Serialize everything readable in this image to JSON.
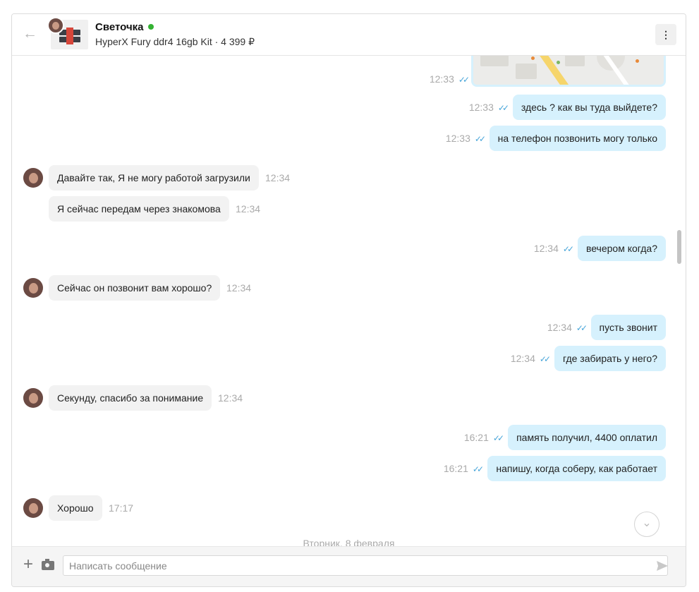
{
  "header": {
    "back_icon": "back-arrow-icon",
    "contact_name": "Светочка",
    "listing": "HyperX Fury ddr4 16gb Kit · 4 399 ₽",
    "menu_icon": "more-vertical-icon"
  },
  "messages": [
    {
      "dir": "out",
      "type": "map",
      "time": "12:33"
    },
    {
      "dir": "out",
      "text": "здесь ? как вы туда выйдете?",
      "time": "12:33"
    },
    {
      "dir": "out",
      "text": "на телефон позвонить могу только",
      "time": "12:33"
    },
    {
      "dir": "in",
      "text": "Давайте так, Я не могу работой загрузили",
      "time": "12:34"
    },
    {
      "dir": "in",
      "text": "Я сейчас передам через знакомова",
      "time": "12:34"
    },
    {
      "dir": "out",
      "text": "вечером когда?",
      "time": "12:34"
    },
    {
      "dir": "in",
      "text": "Сейчас он позвонит вам хорошо?",
      "time": "12:34"
    },
    {
      "dir": "out",
      "text": "пусть звонит",
      "time": "12:34"
    },
    {
      "dir": "out",
      "text": "где забирать у него?",
      "time": "12:34"
    },
    {
      "dir": "in",
      "text": "Секунду, спасибо за понимание",
      "time": "12:34"
    },
    {
      "dir": "out",
      "text": "память получил, 4400 оплатил",
      "time": "16:21"
    },
    {
      "dir": "out",
      "text": "напишу, когда соберу, как работает",
      "time": "16:21"
    },
    {
      "dir": "in",
      "text": "Хорошо",
      "time": "17:17"
    }
  ],
  "date_separator": "Вторник, 8 февраля",
  "composer": {
    "placeholder": "Написать сообщение",
    "attach_icon": "plus-icon",
    "camera_icon": "camera-icon",
    "send_icon": "send-icon"
  },
  "colors": {
    "outgoing_bubble": "#d6f1fd",
    "incoming_bubble": "#f2f2f2",
    "read_ticks": "#47a5d9",
    "online_dot": "#34b233"
  }
}
